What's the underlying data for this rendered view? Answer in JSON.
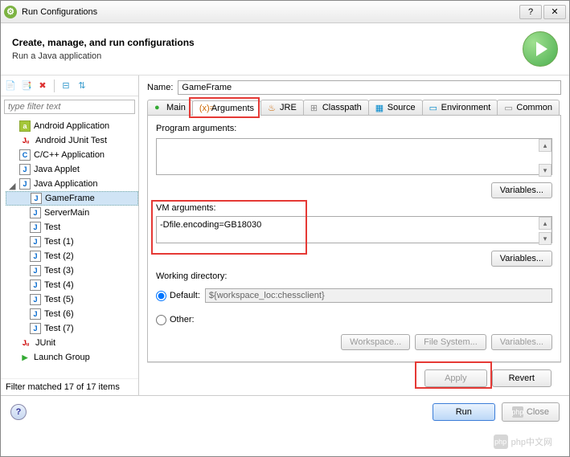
{
  "window": {
    "title": "Run Configurations"
  },
  "header": {
    "title": "Create, manage, and run configurations",
    "subtitle": "Run a Java application"
  },
  "filter": {
    "placeholder": "type filter text",
    "status": "Filter matched 17 of 17 items"
  },
  "tree": [
    {
      "label": "Android Application",
      "icon": "android"
    },
    {
      "label": "Android JUnit Test",
      "icon": "ju"
    },
    {
      "label": "C/C++ Application",
      "icon": "cc"
    },
    {
      "label": "Java Applet",
      "icon": "j"
    },
    {
      "label": "Java Application",
      "icon": "j",
      "expanded": true,
      "children": [
        {
          "label": "GameFrame",
          "selected": true
        },
        {
          "label": "ServerMain"
        },
        {
          "label": "Test"
        },
        {
          "label": "Test (1)"
        },
        {
          "label": "Test (2)"
        },
        {
          "label": "Test (3)"
        },
        {
          "label": "Test (4)"
        },
        {
          "label": "Test (5)"
        },
        {
          "label": "Test (6)"
        },
        {
          "label": "Test (7)"
        }
      ]
    },
    {
      "label": "JUnit",
      "icon": "ju"
    },
    {
      "label": "Launch Group",
      "icon": "play"
    }
  ],
  "form": {
    "name_label": "Name:",
    "name_value": "GameFrame",
    "tabs": [
      "Main",
      "Arguments",
      "JRE",
      "Classpath",
      "Source",
      "Environment",
      "Common"
    ],
    "active_tab": "Arguments",
    "program_args_label": "Program arguments:",
    "program_args_value": "",
    "vm_args_label": "VM arguments:",
    "vm_args_value": "-Dfile.encoding=GB18030",
    "variables_btn": "Variables...",
    "working_dir_label": "Working directory:",
    "default_label": "Default:",
    "default_value": "${workspace_loc:chessclient}",
    "other_label": "Other:",
    "workspace_btn": "Workspace...",
    "filesystem_btn": "File System...",
    "apply_btn": "Apply",
    "revert_btn": "Revert"
  },
  "footer": {
    "run_btn": "Run",
    "close_btn": "Close"
  },
  "watermark": "php中文网"
}
